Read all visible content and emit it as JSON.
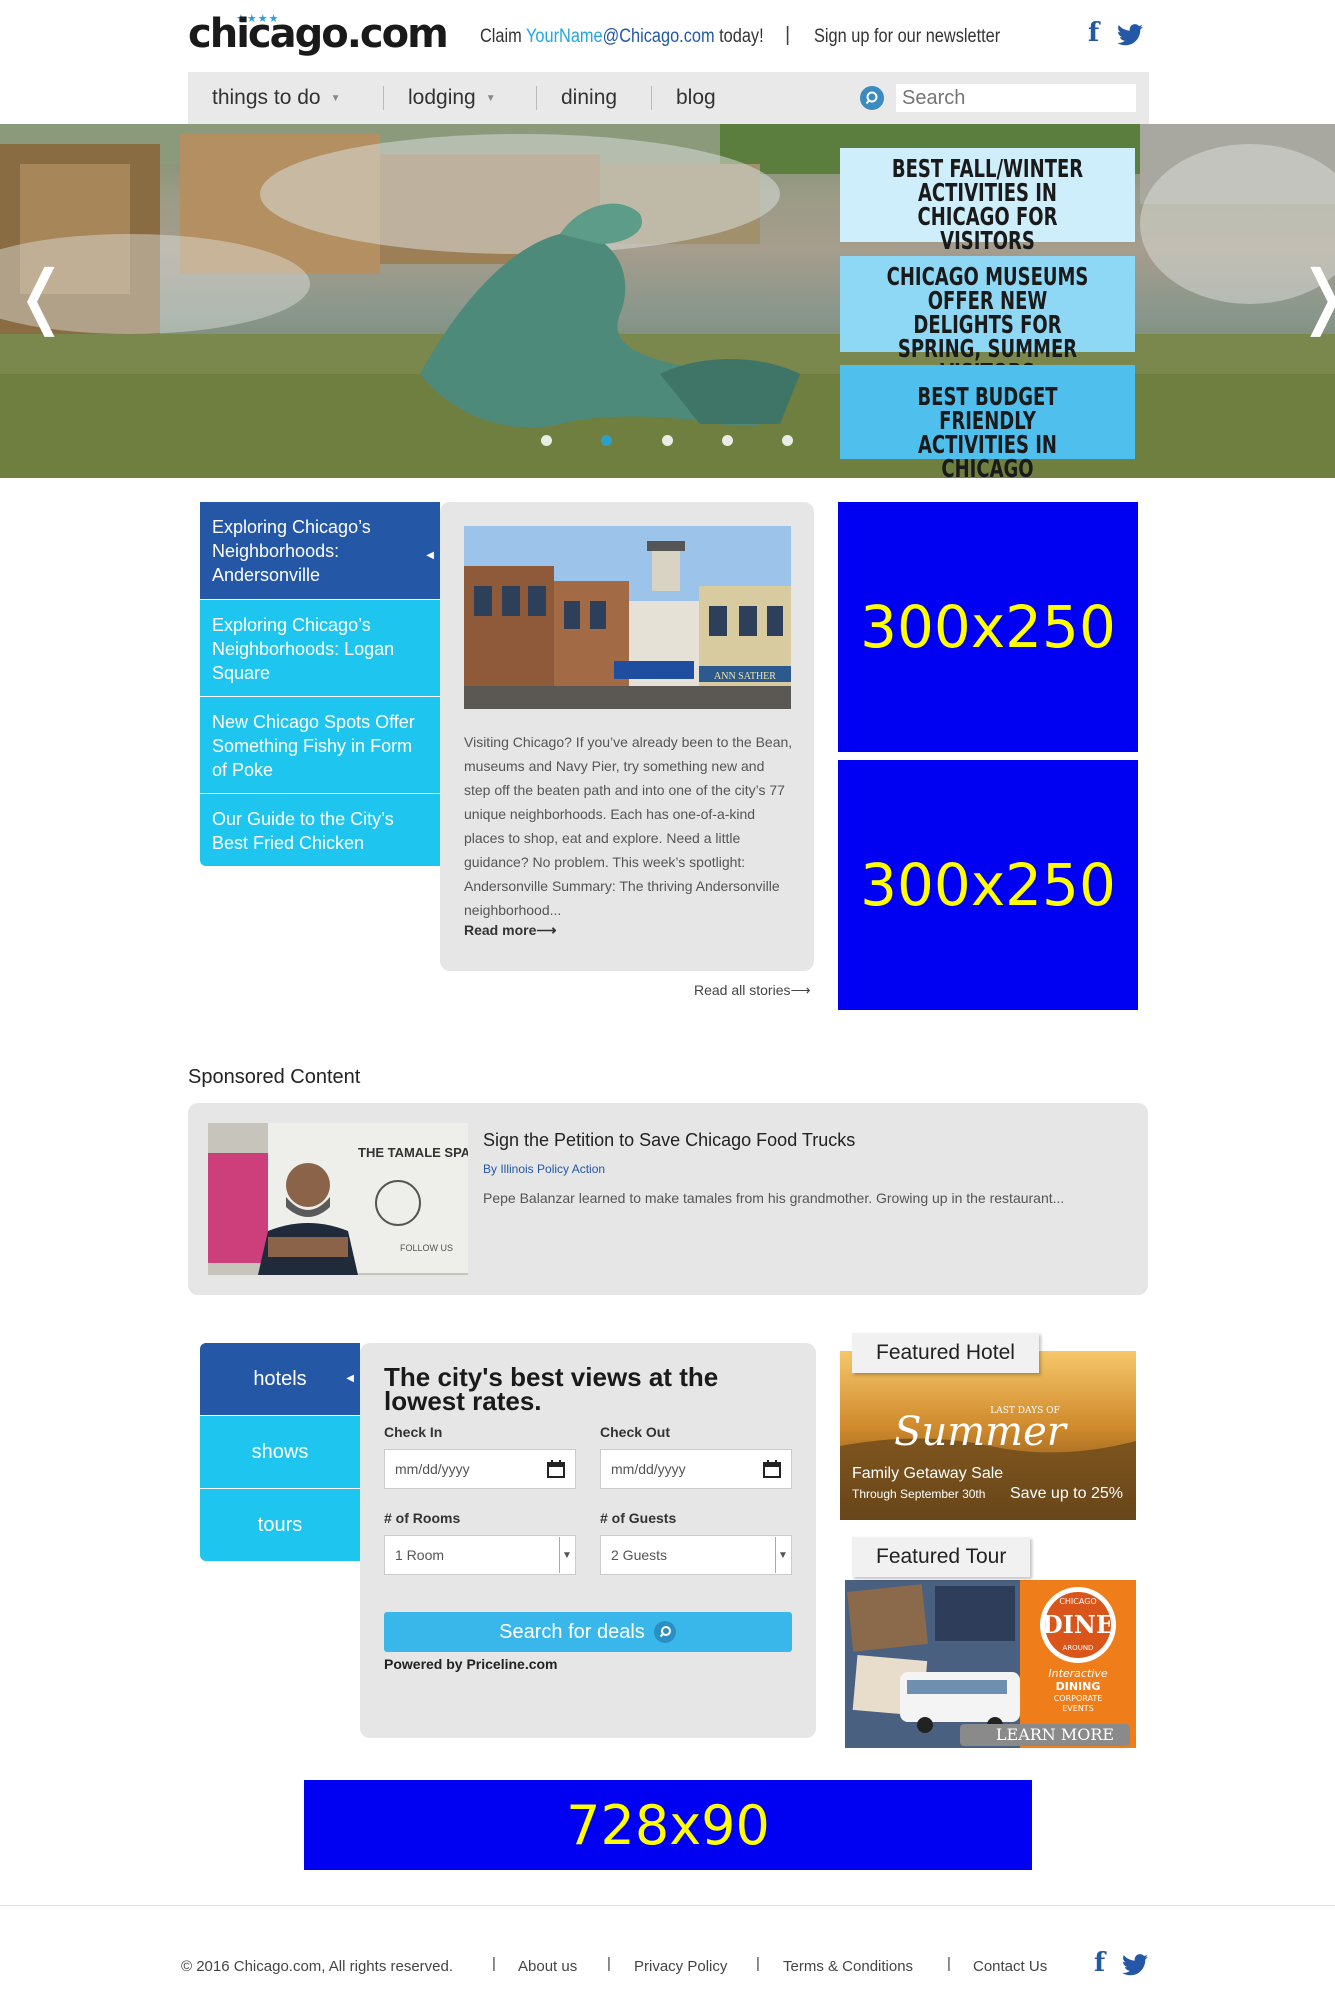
{
  "header": {
    "logo_text": "chicago.com",
    "logo_stars": "★★★★",
    "claim_prefix": "Claim ",
    "claim_email": "YourName",
    "claim_domain": "@Chicago.com",
    "claim_suffix": " today!",
    "separator": "|",
    "newsletter": "Sign up for our newsletter",
    "social": [
      "facebook-icon",
      "twitter-icon"
    ]
  },
  "nav": {
    "items": [
      {
        "label": "things to do",
        "has_dropdown": true
      },
      {
        "label": "lodging",
        "has_dropdown": true
      },
      {
        "label": "dining",
        "has_dropdown": false
      },
      {
        "label": "blog",
        "has_dropdown": false
      }
    ],
    "search_placeholder": "Search"
  },
  "hero": {
    "prev_arrow": "❬",
    "next_arrow": "❭",
    "cards": [
      {
        "title": "Best Fall/Winter Activities in Chicago for Visitors",
        "color": "#cfeefb"
      },
      {
        "title": "Chicago Museums Offer New Delights for Spring, Summer Visitors",
        "color": "#8fd8f5"
      },
      {
        "title": "Best Budget Friendly Activities in Chicago",
        "color": "#4fc0ee"
      }
    ],
    "dots": 5,
    "active_dot": 1
  },
  "stories": {
    "tabs": [
      {
        "label": "Exploring Chicago’s Neighborhoods: Andersonville",
        "active": true
      },
      {
        "label": "Exploring Chicago’s Neighborhoods: Logan Square",
        "active": false
      },
      {
        "label": "New Chicago Spots Offer Something Fishy in Form of Poke",
        "active": false
      },
      {
        "label": "Our Guide to the City’s Best Fried Chicken",
        "active": false
      }
    ],
    "body": "Visiting Chicago? If you’ve already been to the Bean, museums and Navy Pier, try something new and step off the beaten path and into one of the city’s 77 unique neighborhoods. Each has one-of-a-kind places to shop, eat and explore. Need a little guidance? No problem. This week’s spotlight: Andersonville Summary: The thriving Andersonville neighborhood...",
    "read_more": "Read more⟶",
    "all_stories": "Read all stories⟶",
    "image_sign": "ANN SATHER"
  },
  "ads": {
    "side_1": "300x250",
    "side_2": "300x250",
    "leaderboard": "728x90"
  },
  "sponsored": {
    "section_title": "Sponsored Content",
    "headline": "Sign the Petition to Save Chicago Food Trucks",
    "byline": "By Illinois Policy Action",
    "excerpt": "Pepe Balanzar learned to make tamales from his grandmother. Growing up in the restaurant...",
    "truck_text": "THE TAMALE SPACESHIP",
    "truck_follow": "FOLLOW US"
  },
  "booking": {
    "tabs": [
      {
        "label": "hotels",
        "active": true
      },
      {
        "label": "shows",
        "active": false
      },
      {
        "label": "tours",
        "active": false
      }
    ],
    "headline": "The city's best views at the lowest rates.",
    "check_in_label": "Check In",
    "check_out_label": "Check Out",
    "check_in_placeholder": "mm/dd/yyyy",
    "check_out_placeholder": "mm/dd/yyyy",
    "rooms_label": "# of Rooms",
    "guests_label": "# of Guests",
    "rooms_value": "1 Room",
    "guests_value": "2 Guests",
    "search_button": "Search for deals",
    "powered_by": "Powered by Priceline.com"
  },
  "featured": {
    "hotel_label": "Featured Hotel",
    "hotel_ad": {
      "kicker": "LAST DAYS OF",
      "script": "Summer",
      "line1": "Family Getaway Sale",
      "line2": "Through September 30th",
      "offer": "Save up to 25%"
    },
    "tour_label": "Featured Tour",
    "tour_ad": {
      "badge_top": "CHICAGO",
      "badge_main": "DINE",
      "badge_bottom": "AROUND",
      "line1": "Interactive",
      "line2": "DINING",
      "line3": "CORPORATE",
      "line4": "EVENTS",
      "cta": "LEARN MORE"
    }
  },
  "footer": {
    "copyright": "© 2016 Chicago.com, All rights reserved.",
    "links": [
      "About us",
      "Privacy Policy",
      "Terms & Conditions",
      "Contact Us"
    ],
    "separator": "|"
  },
  "colors": {
    "brand_blue": "#2457a5",
    "cyan": "#21a6df",
    "tab_active": "#2457a5",
    "tab_inactive": "#1ec6ef",
    "ad_blue": "#0000f2",
    "ad_yellow": "#ffff00"
  }
}
